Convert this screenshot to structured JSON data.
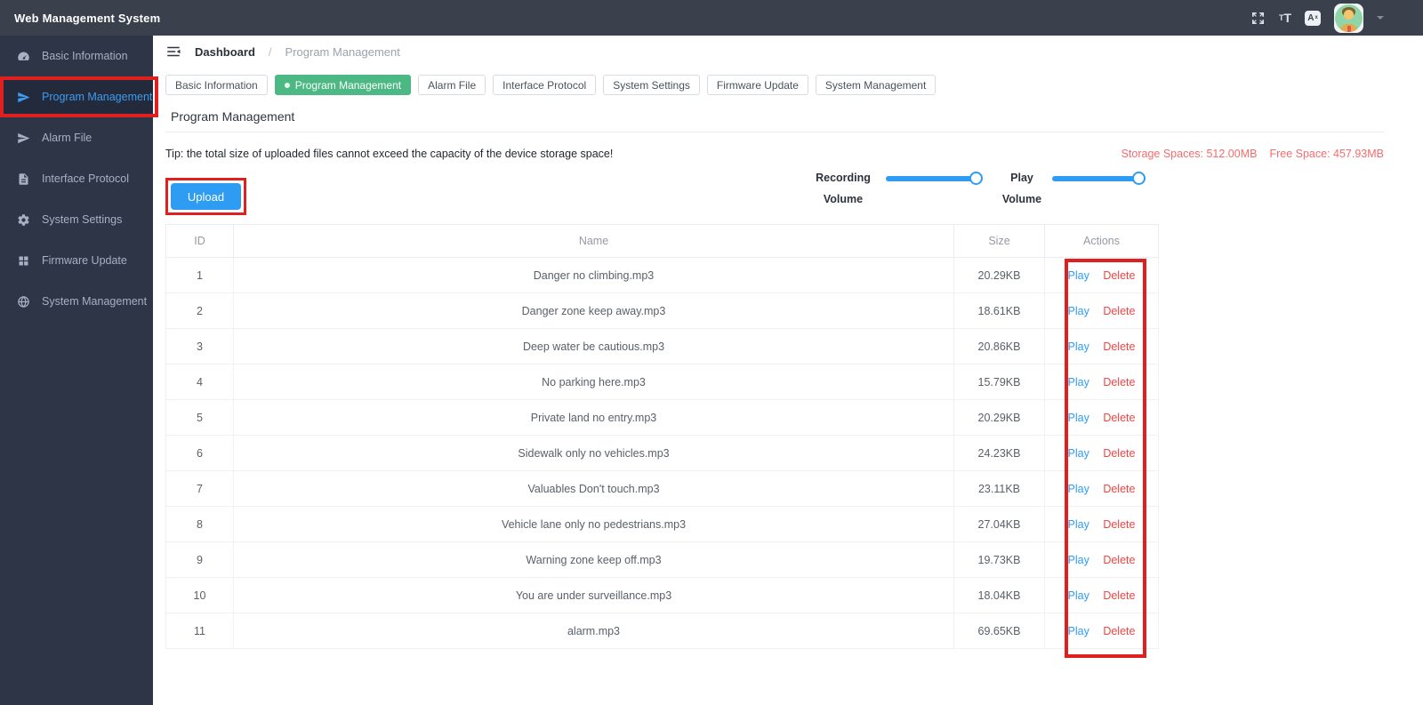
{
  "app": {
    "title": "Web Management System"
  },
  "header": {
    "icons": [
      "fullscreen-icon",
      "font-size-icon",
      "translate-icon",
      "avatar",
      "caret-down-icon"
    ]
  },
  "sidebar": {
    "items": [
      {
        "label": "Basic Information",
        "icon": "gauge",
        "active": false,
        "annotated": false
      },
      {
        "label": "Program Management",
        "icon": "paper-plane",
        "active": true,
        "annotated": true
      },
      {
        "label": "Alarm File",
        "icon": "paper-plane",
        "active": false,
        "annotated": false
      },
      {
        "label": "Interface Protocol",
        "icon": "document",
        "active": false,
        "annotated": false
      },
      {
        "label": "System Settings",
        "icon": "gear",
        "active": false,
        "annotated": false
      },
      {
        "label": "Firmware Update",
        "icon": "grid",
        "active": false,
        "annotated": false
      },
      {
        "label": "System Management",
        "icon": "globe",
        "active": false,
        "annotated": false
      }
    ]
  },
  "breadcrumb": {
    "root": "Dashboard",
    "separator": "/",
    "current": "Program Management"
  },
  "tabs": {
    "items": [
      {
        "label": "Basic Information",
        "active": false
      },
      {
        "label": "Program Management",
        "active": true
      },
      {
        "label": "Alarm File",
        "active": false
      },
      {
        "label": "Interface Protocol",
        "active": false
      },
      {
        "label": "System Settings",
        "active": false
      },
      {
        "label": "Firmware Update",
        "active": false
      },
      {
        "label": "System Management",
        "active": false
      }
    ]
  },
  "page": {
    "title": "Program Management",
    "tip": "Tip: the total size of uploaded files cannot exceed the capacity of the device storage space!",
    "storage": "Storage Spaces: 512.00MB",
    "free": "Free Space: 457.93MB",
    "upload_label": "Upload"
  },
  "sliders": [
    {
      "line1": "Recording",
      "line2": "Volume",
      "value": 100
    },
    {
      "line1": "Play",
      "line2": "Volume",
      "value": 100
    }
  ],
  "table": {
    "headers": [
      "ID",
      "Name",
      "Size",
      "Actions"
    ],
    "actions": {
      "play": "Play",
      "delete": "Delete"
    },
    "rows": [
      {
        "id": "1",
        "name": "Danger no climbing.mp3",
        "size": "20.29KB"
      },
      {
        "id": "2",
        "name": "Danger zone keep away.mp3",
        "size": "18.61KB"
      },
      {
        "id": "3",
        "name": "Deep water be cautious.mp3",
        "size": "20.86KB"
      },
      {
        "id": "4",
        "name": "No parking here.mp3",
        "size": "15.79KB"
      },
      {
        "id": "5",
        "name": "Private land no entry.mp3",
        "size": "20.29KB"
      },
      {
        "id": "6",
        "name": "Sidewalk only no vehicles.mp3",
        "size": "24.23KB"
      },
      {
        "id": "7",
        "name": "Valuables Don't touch.mp3",
        "size": "23.11KB"
      },
      {
        "id": "8",
        "name": "Vehicle lane only no pedestrians.mp3",
        "size": "27.04KB"
      },
      {
        "id": "9",
        "name": "Warning zone keep off.mp3",
        "size": "19.73KB"
      },
      {
        "id": "10",
        "name": "You are under surveillance.mp3",
        "size": "18.04KB"
      },
      {
        "id": "11",
        "name": "alarm.mp3",
        "size": "69.65KB"
      }
    ]
  },
  "colors": {
    "accent": "#2e9cf3",
    "tab_active_green": "#4cb883",
    "annotation_red": "#e01f1f",
    "delete_red": "#f24444",
    "storage_red": "#f56c6c",
    "sidebar_active_blue": "#3f9bee",
    "topbar_bg": "#3a414d",
    "sidebar_bg": "#2d3547"
  }
}
